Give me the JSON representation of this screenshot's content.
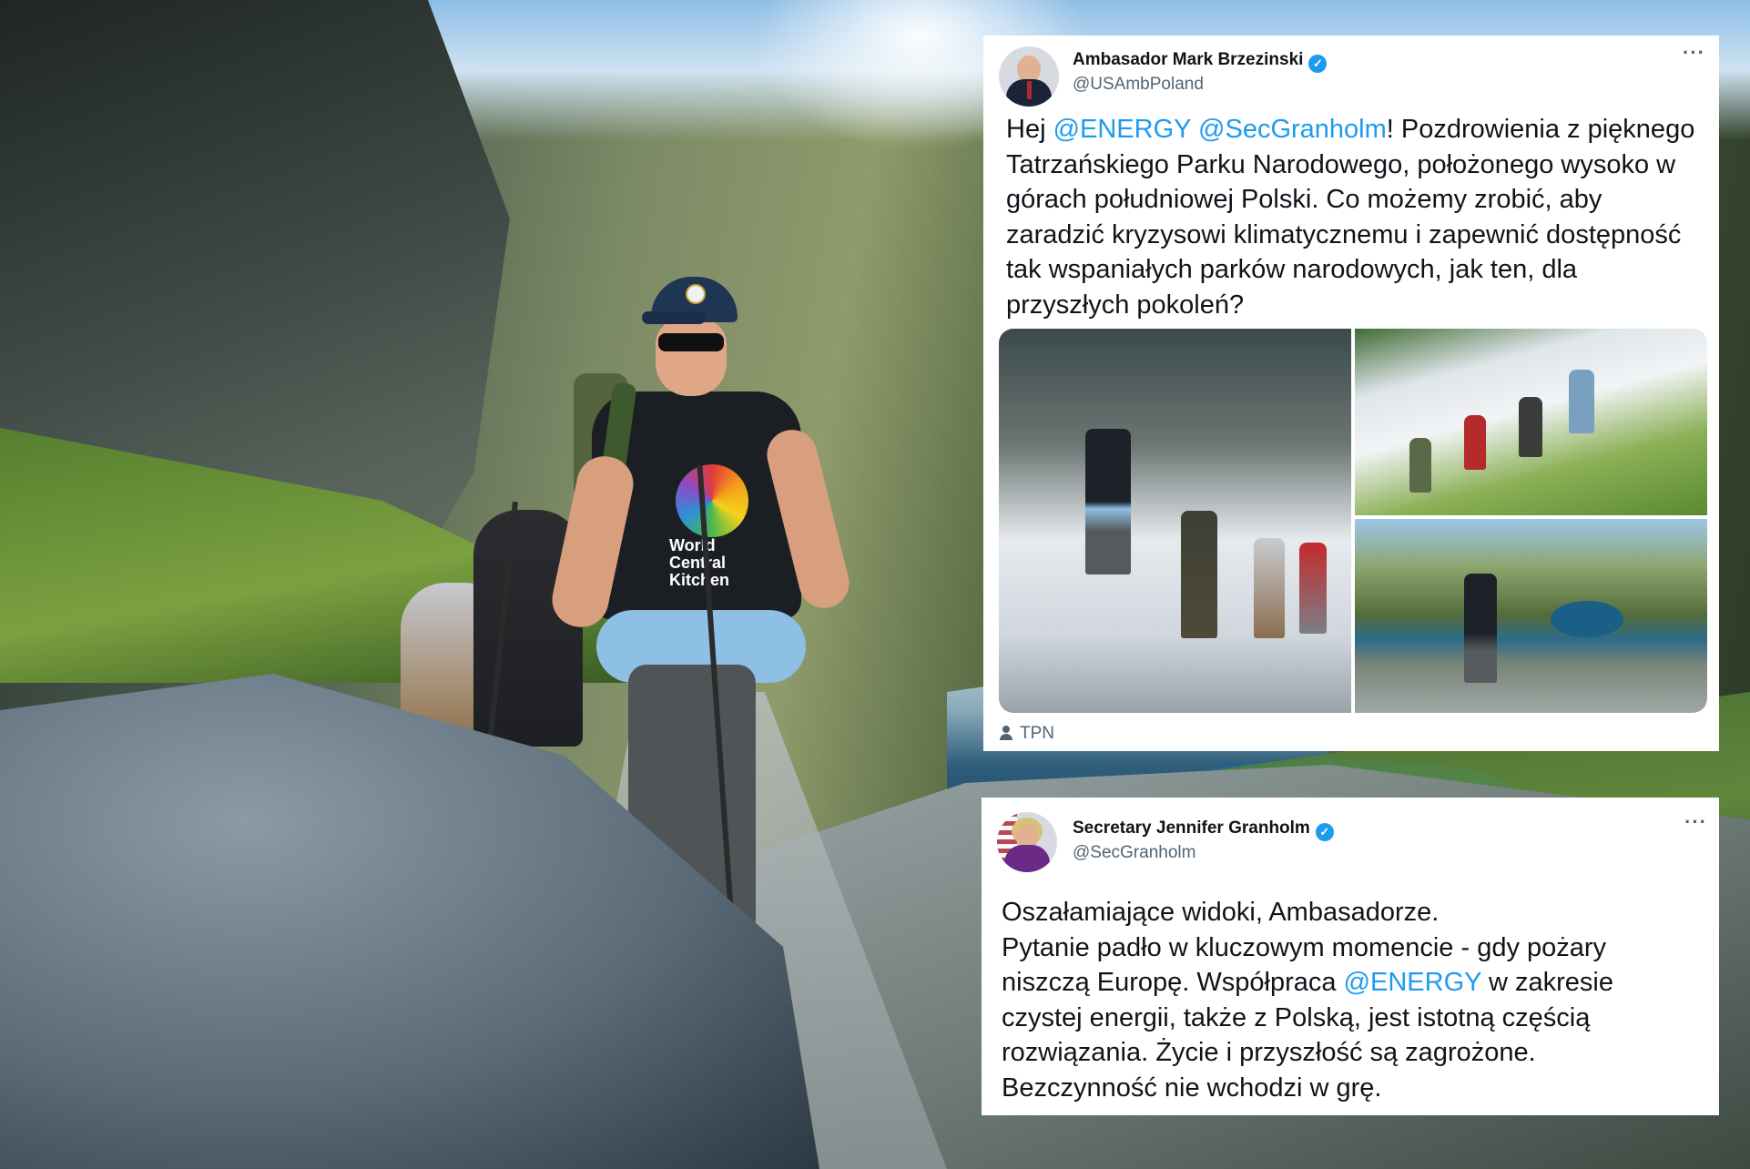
{
  "tweet1": {
    "display_name": "Ambasador Mark Brzezinski",
    "handle": "@USAmbPoland",
    "more": "···",
    "text": {
      "hej": "Hej ",
      "mention1": "@ENERGY",
      "space": " ",
      "mention2": "@SecGranholm",
      "rest": "! Pozdrowienia z pięknego Tatrzańskiego Parku Narodowego, położonego wysoko w górach południowej Polski. Co możemy zrobić, aby zaradzić kryzysowi klimatycznemu i zapewnić dostępność tak wspaniałych parków narodowych, jak ten, dla przyszłych pokoleń?"
    },
    "photo_credit": "TPN"
  },
  "tweet2": {
    "display_name": "Secretary Jennifer Granholm",
    "handle": "@SecGranholm",
    "more": "···",
    "text": {
      "line1": "Oszałamiające widoki, Ambasadorze.",
      "part_a": "Pytanie padło w kluczowym momencie - gdy pożary niszczą Europę. Współpraca ",
      "mention": "@ENERGY",
      "part_b": " w zakresie czystej energii, także z Polską, jest istotną częścią rozwiązania. Życie i przyszłość są zagrożone. Bezczynność nie wchodzi w grę."
    }
  },
  "shirt_text": "World Central Kitchen",
  "colors": {
    "mention": "#1d9bf0",
    "verified": "#1d9bf0",
    "text": "#0f1419",
    "secondary": "#536471"
  },
  "icons": [
    "verified-badge-icon",
    "more-options-icon",
    "person-icon"
  ]
}
